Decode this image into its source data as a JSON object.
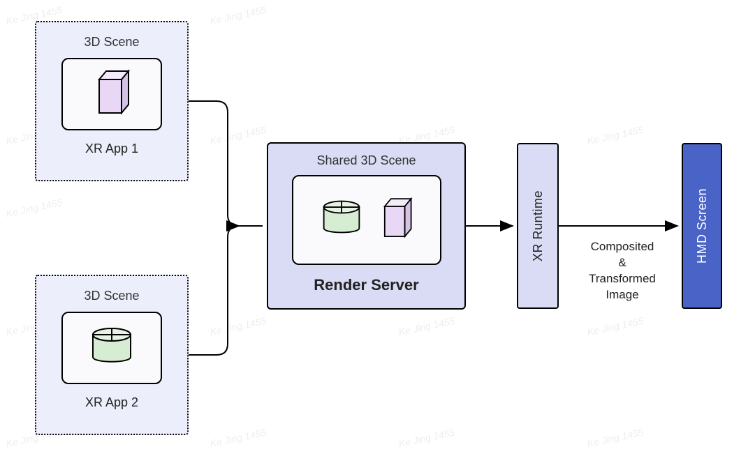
{
  "watermark": "Ke Jing 1455",
  "app1": {
    "scene_title": "3D Scene",
    "name": "XR App 1",
    "shape": "cube"
  },
  "app2": {
    "scene_title": "3D Scene",
    "name": "XR App 2",
    "shape": "cylinder"
  },
  "server": {
    "scene_title": "Shared 3D Scene",
    "name": "Render Server",
    "shapes": [
      "cylinder",
      "cube"
    ]
  },
  "runtime": {
    "label": "XR Runtime"
  },
  "arrow_caption": "Composited\n&\nTransformed\nImage",
  "hmd": {
    "label": "HMD Screen"
  },
  "colors": {
    "panel_light": "#eceefb",
    "panel_mid": "#d9dcf4",
    "hmd_fill": "#4a63c6",
    "cube_fill": "#e9d8f5",
    "cyl_fill": "#d6ecd3"
  }
}
